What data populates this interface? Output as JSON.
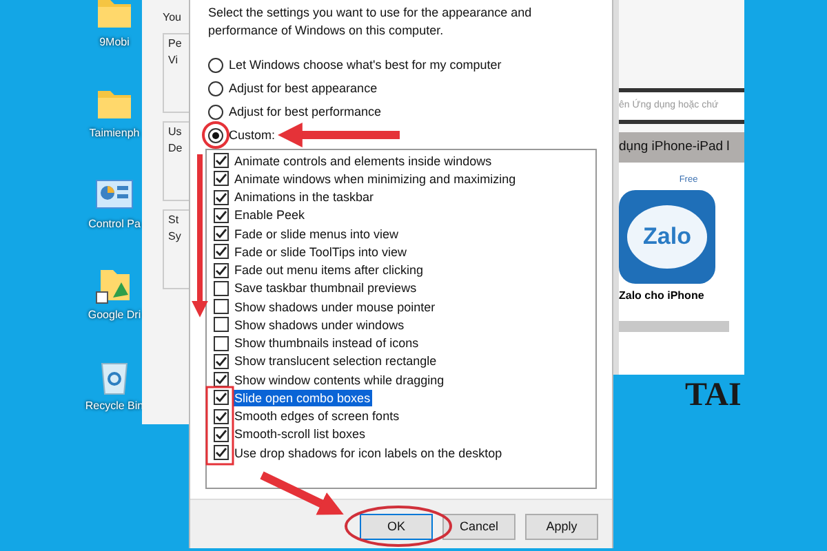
{
  "desktop_icons": [
    {
      "label": "9Mobi",
      "kind": "folder"
    },
    {
      "label": "Taimienph",
      "kind": "folder"
    },
    {
      "label": "Control Pa",
      "kind": "control"
    },
    {
      "label": "Google Dri",
      "kind": "drive"
    },
    {
      "label": "Recycle Bin",
      "kind": "recycle"
    }
  ],
  "back_window": {
    "lines": [
      "You",
      "Pe",
      "Vi",
      "Us",
      "De",
      "St",
      "Sy"
    ]
  },
  "dialog": {
    "description": "Select the settings you want to use for the appearance and performance of Windows on this computer.",
    "options": [
      {
        "label": "Let Windows choose what's best for my computer",
        "selected": false
      },
      {
        "label": "Adjust for best appearance",
        "selected": false
      },
      {
        "label": "Adjust for best performance",
        "selected": false
      },
      {
        "label": "Custom:",
        "selected": true
      }
    ],
    "effects": [
      {
        "label": "Animate controls and elements inside windows",
        "checked": true,
        "selected": false
      },
      {
        "label": "Animate windows when minimizing and maximizing",
        "checked": true,
        "selected": false
      },
      {
        "label": "Animations in the taskbar",
        "checked": true,
        "selected": false
      },
      {
        "label": "Enable Peek",
        "checked": true,
        "selected": false
      },
      {
        "label": "Fade or slide menus into view",
        "checked": true,
        "selected": false
      },
      {
        "label": "Fade or slide ToolTips into view",
        "checked": true,
        "selected": false
      },
      {
        "label": "Fade out menu items after clicking",
        "checked": true,
        "selected": false
      },
      {
        "label": "Save taskbar thumbnail previews",
        "checked": false,
        "selected": false
      },
      {
        "label": "Show shadows under mouse pointer",
        "checked": false,
        "selected": false
      },
      {
        "label": "Show shadows under windows",
        "checked": false,
        "selected": false
      },
      {
        "label": "Show thumbnails instead of icons",
        "checked": false,
        "selected": false
      },
      {
        "label": "Show translucent selection rectangle",
        "checked": true,
        "selected": false
      },
      {
        "label": "Show window contents while dragging",
        "checked": true,
        "selected": false
      },
      {
        "label": "Slide open combo boxes",
        "checked": true,
        "selected": true
      },
      {
        "label": "Smooth edges of screen fonts",
        "checked": true,
        "selected": false
      },
      {
        "label": "Smooth-scroll list boxes",
        "checked": true,
        "selected": false
      },
      {
        "label": "Use drop shadows for icon labels on the desktop",
        "checked": true,
        "selected": false
      }
    ],
    "buttons": [
      {
        "label": "OK",
        "default": true
      },
      {
        "label": "Cancel",
        "default": false
      },
      {
        "label": "Apply",
        "default": false
      }
    ]
  },
  "browser": {
    "search_text": "ên Ứng dụng hoặc chứ",
    "banner": "dụng iPhone-iPad l",
    "app": {
      "price": "Free",
      "icon_text": "Zalo",
      "name": "Zalo cho iPhone"
    }
  },
  "desktop_text": "TAI"
}
